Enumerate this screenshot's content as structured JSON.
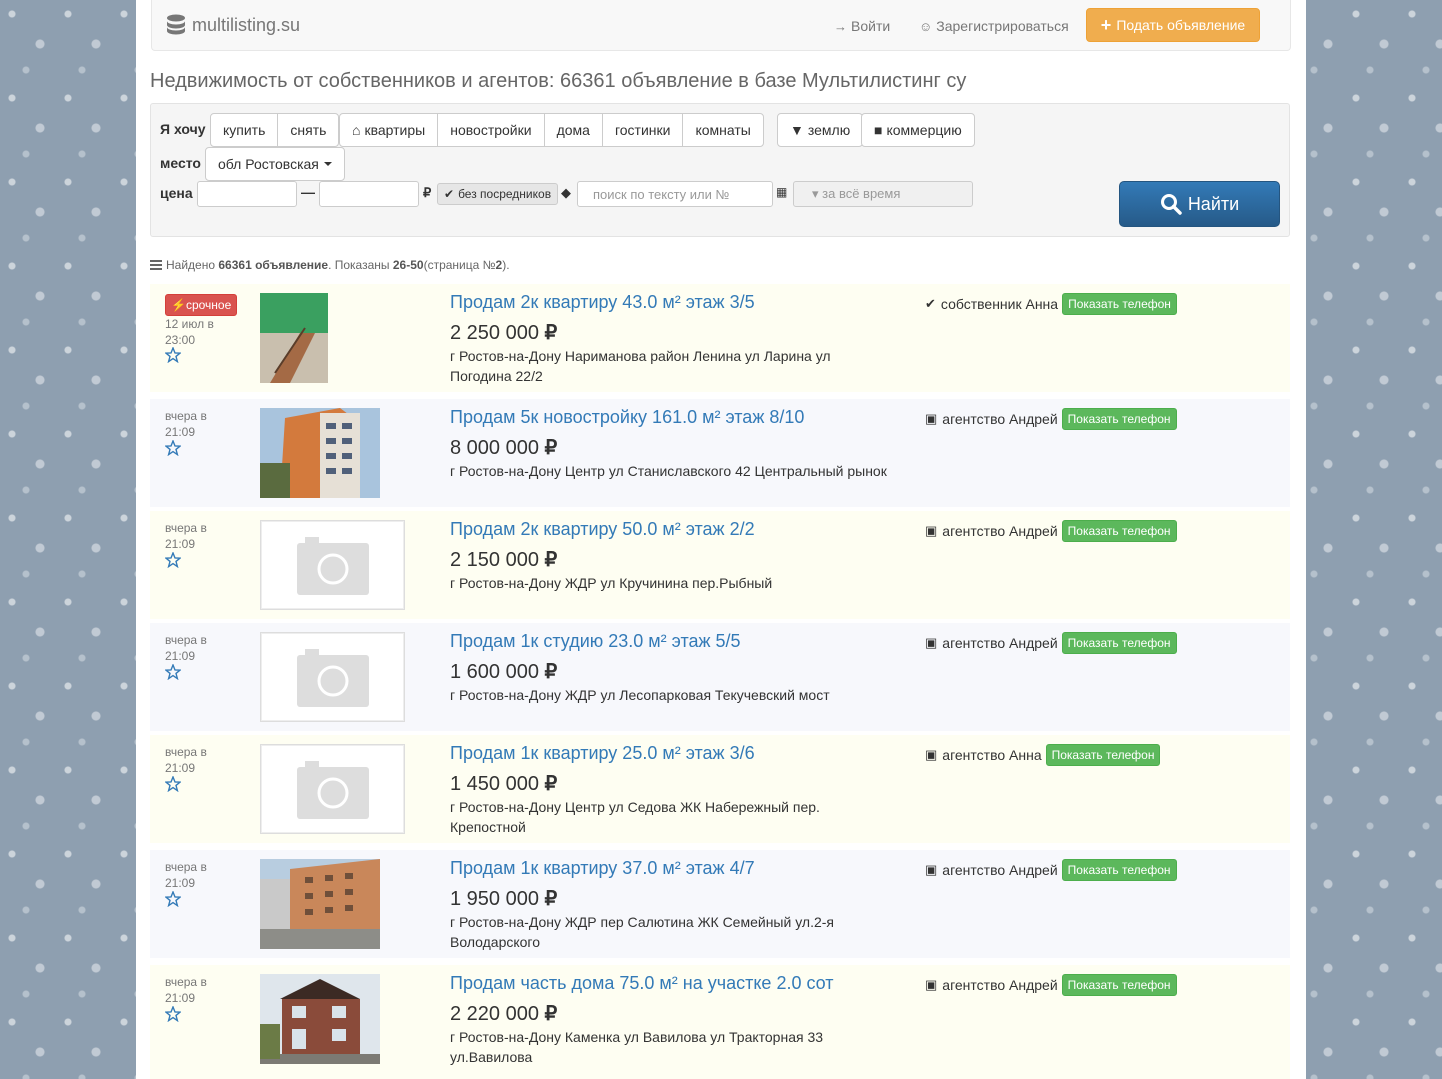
{
  "header": {
    "brand": "multilisting.su",
    "login": "Войти",
    "register": "Зарегистрироваться",
    "post_ad": "Подать объявление"
  },
  "page_title": "Недвижимость от собственников и агентов: 66361 объявление в базе Мультилистинг су",
  "filter": {
    "want_label": "Я хочу",
    "deal_buttons": [
      "купить",
      "снять"
    ],
    "type_buttons": [
      "квартиры",
      "новостройки",
      "дома",
      "гостинки",
      "комнаты"
    ],
    "land_button": "землю",
    "commerce_button": "коммерцию",
    "place_label": "место",
    "place_value": "обл Ростовская",
    "price_label": "цена",
    "price_dash": "—",
    "currency": "₽",
    "no_agents": "без посредников",
    "search_placeholder": "поиск по тексту или №",
    "period_value": "▾ за всё время",
    "find_button": "Найти"
  },
  "results": {
    "found_prefix": "Найдено ",
    "found_count": "66361 объявление",
    "shown_prefix": ". Показаны ",
    "shown_range": "26-50",
    "page_prefix": " (страница №",
    "page_num": "2",
    "page_suffix": ")."
  },
  "listings": [
    {
      "urgent": "срочное",
      "date": "12 июл в 23:00",
      "title": "Продам 2к квартиру 43.0 м² этаж 3/5",
      "price": "2 250 000",
      "currency": "₽",
      "address": "г Ростов-на-Дону Нариманова район Ленина ул Ларина ул Погодина 22/2",
      "seller": "собственник Анна",
      "seller_icon": "check-icon",
      "phone_button": "Показать телефон",
      "photo": "stairwell"
    },
    {
      "date": "вчера в 21:09",
      "title": "Продам 5к новостройку 161.0 м² этаж 8/10",
      "price": "8 000 000",
      "currency": "₽",
      "address": "г Ростов-на-Дону Центр ул Станиславского 42 Центральный рынок",
      "seller": "агентство Андрей",
      "seller_icon": "cube-icon",
      "phone_button": "Показать телефон",
      "photo": "building"
    },
    {
      "date": "вчера в 21:09",
      "title": "Продам 2к квартиру 50.0 м² этаж 2/2",
      "price": "2 150 000",
      "currency": "₽",
      "address": "г Ростов-на-Дону ЖДР ул Кручинина пер.Рыбный",
      "seller": "агентство Андрей",
      "seller_icon": "cube-icon",
      "phone_button": "Показать телефон",
      "photo": "none"
    },
    {
      "date": "вчера в 21:09",
      "title": "Продам 1к студию 23.0 м² этаж 5/5",
      "price": "1 600 000",
      "currency": "₽",
      "address": "г Ростов-на-Дону ЖДР ул Лесопарковая Текучевский мост",
      "seller": "агентство Андрей",
      "seller_icon": "cube-icon",
      "phone_button": "Показать телефон",
      "photo": "none"
    },
    {
      "date": "вчера в 21:09",
      "title": "Продам 1к квартиру 25.0 м² этаж 3/6",
      "price": "1 450 000",
      "currency": "₽",
      "address": "г Ростов-на-Дону Центр ул Седова ЖК Набережный пер. Крепостной",
      "seller": "агентство Анна",
      "seller_icon": "cube-icon",
      "phone_button": "Показать телефон",
      "photo": "none"
    },
    {
      "date": "вчера в 21:09",
      "title": "Продам 1к квартиру 37.0 м² этаж 4/7",
      "price": "1 950 000",
      "currency": "₽",
      "address": "г Ростов-на-Дону ЖДР пер Салютина ЖК Семейный ул.2-я Володарского",
      "seller": "агентство Андрей",
      "seller_icon": "cube-icon",
      "phone_button": "Показать телефон",
      "photo": "street"
    },
    {
      "date": "вчера в 21:09",
      "title": "Продам часть дома 75.0 м² на участке 2.0 сот",
      "price": "2 220 000",
      "currency": "₽",
      "address": "г Ростов-на-Дону Каменка ул Вавилова ул Тракторная 33 ул.Вавилова",
      "seller": "агентство Андрей",
      "seller_icon": "cube-icon",
      "phone_button": "Показать телефон",
      "photo": "house"
    }
  ],
  "colors": {
    "accent_orange": "#f0ad4e",
    "link_blue": "#337ab7",
    "urgent_red": "#d9534f",
    "phone_green": "#5cb85c",
    "find_blue": "#2b6aae"
  }
}
